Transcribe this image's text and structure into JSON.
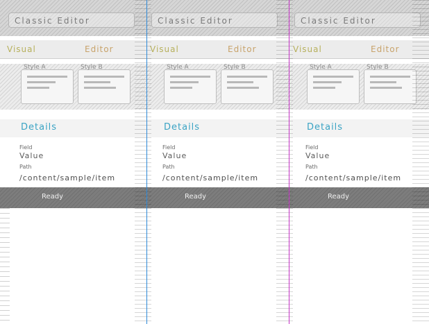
{
  "panes": [
    {
      "title": "Classic Editor",
      "tabs": [
        "Visual",
        "Editor"
      ],
      "thumbs": [
        {
          "label": "Style A"
        },
        {
          "label": "Style B"
        }
      ],
      "link": "Details",
      "info": {
        "label1": "Field",
        "value1": "Value",
        "label2": "Path",
        "path": "/content/sample/item"
      },
      "status": "Ready"
    },
    {
      "title": "Classic Editor",
      "tabs": [
        "Visual",
        "Editor"
      ],
      "thumbs": [
        {
          "label": "Style A"
        },
        {
          "label": "Style B"
        }
      ],
      "link": "Details",
      "info": {
        "label1": "Field",
        "value1": "Value",
        "label2": "Path",
        "path": "/content/sample/item"
      },
      "status": "Ready"
    },
    {
      "title": "Classic Editor",
      "tabs": [
        "Visual",
        "Editor"
      ],
      "thumbs": [
        {
          "label": "Style A"
        },
        {
          "label": "Style B"
        }
      ],
      "link": "Details",
      "info": {
        "label1": "Field",
        "value1": "Value",
        "label2": "Path",
        "path": "/content/sample/item"
      },
      "status": "Ready"
    }
  ],
  "colors": {
    "accent_blue": "#2e8ad9",
    "accent_magenta": "#c533c6",
    "link": "#3aa3c4",
    "tab_a": "#b7b05c",
    "tab_b": "#c8a36b"
  }
}
